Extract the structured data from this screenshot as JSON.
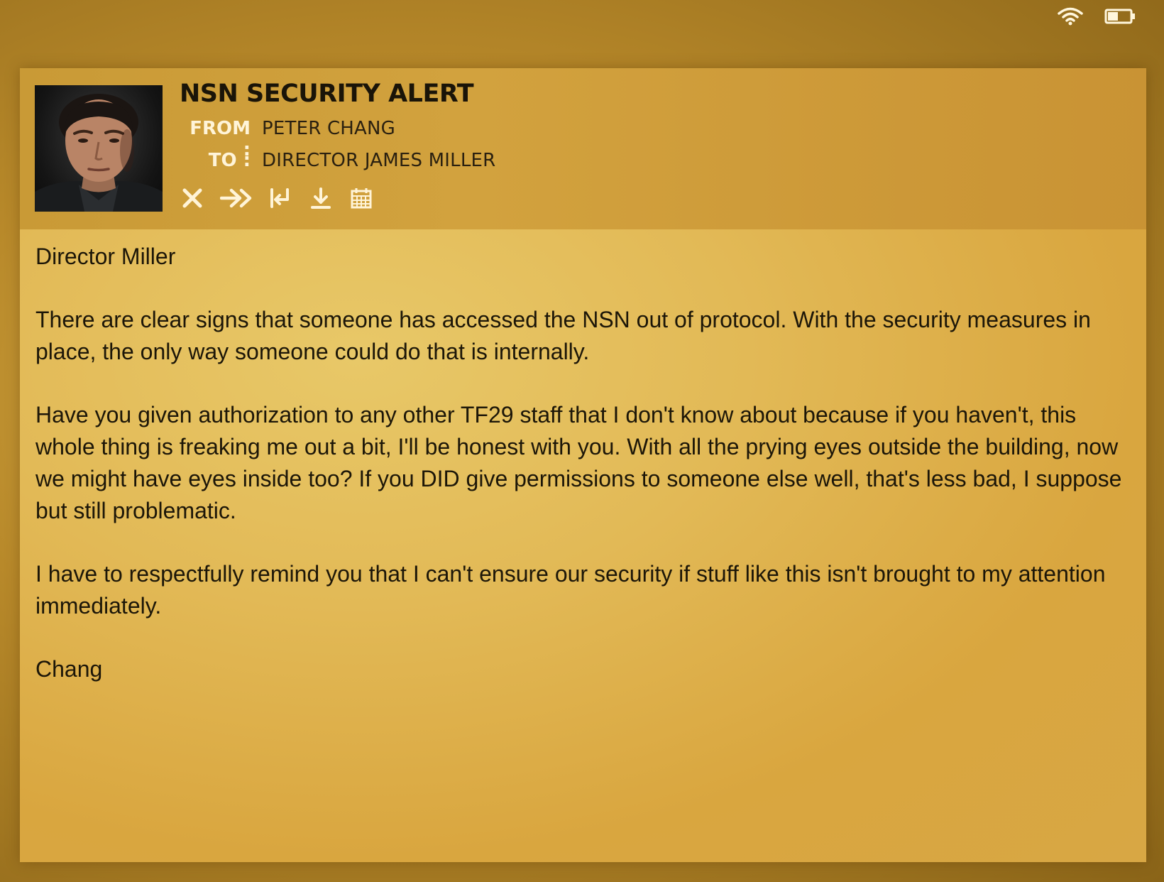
{
  "status_bar": {
    "wifi_icon": "wifi-icon",
    "battery_icon": "battery-icon"
  },
  "email": {
    "subject": "NSN SECURITY ALERT",
    "from_label": "FROM :",
    "from_value": "PETER CHANG",
    "to_label": "TO :",
    "to_value": "DIRECTOR JAMES MILLER",
    "toolbar": [
      "close-icon",
      "forward-icon",
      "reply-icon",
      "download-icon",
      "calendar-icon"
    ],
    "body": {
      "greeting": "Director Miller",
      "paragraph_1": "There are clear signs that someone has accessed the NSN out of protocol. With the security measures in place, the only way someone could do that is internally.",
      "paragraph_2": "Have you given authorization to any other TF29 staff that I don't know about because if you haven't, this whole thing is freaking me out a bit, I'll be honest with you. With all the prying eyes outside the building, now we might have eyes inside too? If you DID give permissions to someone else well, that's less bad, I suppose but still problematic.",
      "paragraph_3": "I have to respectfully remind you that I can't ensure our security if stuff like this isn't brought to my attention immediately.",
      "signature": "Chang"
    }
  },
  "colors": {
    "header_bg": "#d2a23e",
    "body_bg": "#e2b956",
    "label_color": "#fff4d8",
    "text_color": "#1c1608"
  }
}
